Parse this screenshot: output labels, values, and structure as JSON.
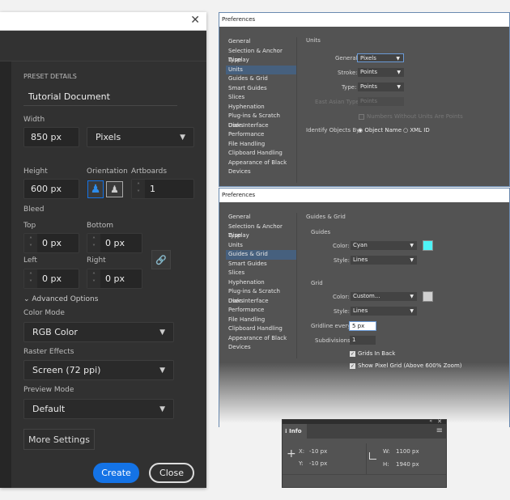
{
  "new_document": {
    "close_icon": "close-icon",
    "section": "PRESET DETAILS",
    "name": "Tutorial Document",
    "width_label": "Width",
    "width": "850 px",
    "units": "Pixels",
    "height_label": "Height",
    "height": "600 px",
    "orientation_label": "Orientation",
    "artboards_label": "Artboards",
    "artboards": "1",
    "bleed_label": "Bleed",
    "top_label": "Top",
    "top": "0 px",
    "bottom_label": "Bottom",
    "bottom": "0 px",
    "left_label": "Left",
    "left": "0 px",
    "right_label": "Right",
    "right": "0 px",
    "advanced": "Advanced Options",
    "color_mode_label": "Color Mode",
    "color_mode": "RGB Color",
    "raster_label": "Raster Effects",
    "raster": "Screen (72 ppi)",
    "preview_label": "Preview Mode",
    "preview": "Default",
    "more": "More Settings",
    "create": "Create",
    "close": "Close",
    "accent": "#1473e6"
  },
  "prefs_units": {
    "title": "Preferences",
    "sidebar": [
      "General",
      "Selection & Anchor Display",
      "Type",
      "Units",
      "Guides & Grid",
      "Smart Guides",
      "Slices",
      "Hyphenation",
      "Plug-ins & Scratch Disks",
      "User Interface",
      "Performance",
      "File Handling",
      "Clipboard Handling",
      "Appearance of Black",
      "Devices"
    ],
    "selected": "Units",
    "heading": "Units",
    "general_label": "General:",
    "general": "Pixels",
    "stroke_label": "Stroke:",
    "stroke": "Points",
    "type_label": "Type:",
    "type": "Points",
    "east_label": "East Asian Type:",
    "east": "Points",
    "numbers": "Numbers Without Units Are Points",
    "identify_label": "Identify Objects By:",
    "opt_name": "Object Name",
    "opt_xml": "XML ID"
  },
  "prefs_grid": {
    "title": "Preferences",
    "selected": "Guides & Grid",
    "heading": "Guides & Grid",
    "guides": "Guides",
    "color_label": "Color:",
    "guide_color": "Cyan",
    "guide_swatch": "#4ef3f6",
    "style_label": "Style:",
    "guide_style": "Lines",
    "grid": "Grid",
    "grid_color": "Custom...",
    "grid_swatch": "#d0d0d0",
    "grid_style": "Lines",
    "gridline_label": "Gridline every:",
    "gridline": "5 px",
    "subdiv_label": "Subdivisions:",
    "subdiv": "1",
    "back": "Grids In Back",
    "pixel": "Show Pixel Grid (Above 600% Zoom)"
  },
  "info": {
    "tab": "Info",
    "x_label": "X:",
    "x": "-10 px",
    "y_label": "Y:",
    "y": "-10 px",
    "w_label": "W:",
    "w": "1100 px",
    "h_label": "H:",
    "h": "1940 px"
  }
}
